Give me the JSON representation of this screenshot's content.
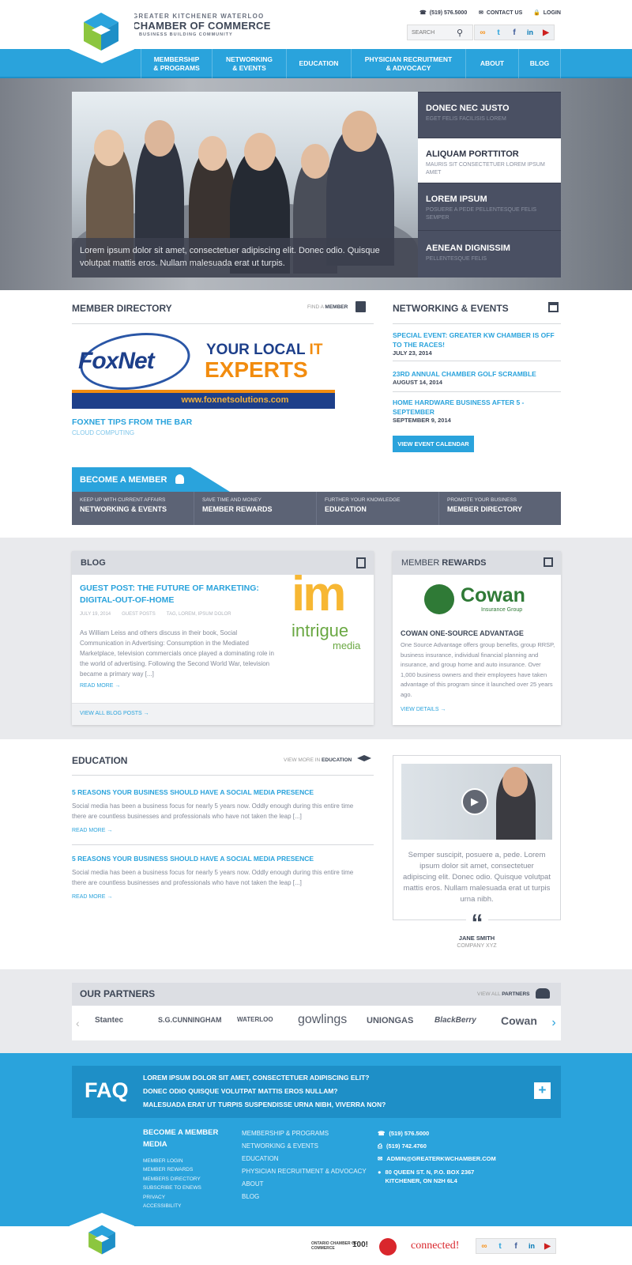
{
  "header": {
    "org_line1": "GREATER KITCHENER WATERLOO",
    "org_line2": "CHAMBER OF COMMERCE",
    "org_line3": "BUSINESS BUILDING COMMUNITY",
    "phone": "(519) 576.5000",
    "contact": "CONTACT US",
    "login": "LOGIN",
    "search_placeholder": "SEARCH",
    "social": [
      "rss-icon",
      "twitter-icon",
      "facebook-icon",
      "linkedin-icon",
      "youtube-icon"
    ]
  },
  "nav": [
    {
      "line1": "MEMBERSHIP",
      "line2": "& PROGRAMS"
    },
    {
      "line1": "NETWORKING",
      "line2": "& EVENTS"
    },
    {
      "line1": "EDUCATION",
      "line2": ""
    },
    {
      "line1": "PHYSICIAN RECRUITMENT",
      "line2": "& ADVOCACY"
    },
    {
      "line1": "ABOUT",
      "line2": ""
    },
    {
      "line1": "BLOG",
      "line2": ""
    }
  ],
  "hero": {
    "caption": "Lorem ipsum dolor sit amet, consectetuer adipiscing elit. Donec odio. Quisque volutpat mattis eros. Nullam malesuada erat ut turpis.",
    "slides": [
      {
        "title": "DONEC NEC JUSTO",
        "sub": "EGET FELIS FACILISIS LOREM"
      },
      {
        "title": "ALIQUAM PORTTITOR",
        "sub": "MAURIS SIT CONSECTETUER LOREM IPSUM AMET"
      },
      {
        "title": "LOREM IPSUM",
        "sub": "POSUERE A PEDE PELLENTESQUE FELIS SEMPER"
      },
      {
        "title": "AENEAN DIGNISSIM",
        "sub": "PELLENTESQUE FELIS"
      }
    ]
  },
  "member_directory": {
    "heading": "MEMBER DIRECTORY",
    "find_pre": "FIND A",
    "find_bold": "MEMBER",
    "ad_brand": "FoxNet",
    "ad_tag1": "YOUR LOCAL",
    "ad_tag_it": "IT",
    "ad_tag2": "EXPERTS",
    "ad_url": "www.foxnetsolutions.com",
    "feature_title": "FOXNET TIPS FROM THE BAR",
    "feature_cat": "CLOUD COMPUTING"
  },
  "events": {
    "heading": "NETWORKING & EVENTS",
    "items": [
      {
        "title": "SPECIAL EVENT: GREATER KW CHAMBER IS OFF TO THE RACES!",
        "date": "JULY 23, 2014"
      },
      {
        "title": "23RD ANNUAL CHAMBER GOLF SCRAMBLE",
        "date": "AUGUST 14, 2014"
      },
      {
        "title": "HOME HARDWARE BUSINESS AFTER 5 - SEPTEMBER",
        "date": "SEPTEMBER 9, 2014"
      }
    ],
    "button": "VIEW EVENT CALENDAR"
  },
  "become_member": {
    "label": "BECOME A MEMBER",
    "cells": [
      {
        "small": "KEEP UP WITH CURRENT AFFAIRS",
        "big": "NETWORKING & EVENTS"
      },
      {
        "small": "SAVE TIME AND MONEY",
        "big": "MEMBER REWARDS"
      },
      {
        "small": "FURTHER YOUR KNOWLEDGE",
        "big": "EDUCATION"
      },
      {
        "small": "PROMOTE YOUR BUSINESS",
        "big": "MEMBER DIRECTORY"
      }
    ]
  },
  "blog": {
    "heading": "BLOG",
    "title": "GUEST POST: THE FUTURE OF MARKETING: DIGITAL-OUT-OF-HOME",
    "date": "JULY 19, 2014",
    "category": "GUEST POSTS",
    "tags": "TAG, LOREM, IPSUM DOLOR",
    "body": "As William Leiss and others discuss in their book, Social Communication in Advertising: Consumption in the Mediated Marketplace, television commercials once played a dominating role in the world of advertising. Following the Second World War, television became a primary way [...]",
    "read_more": "READ MORE →",
    "view_all": "VIEW ALL BLOG POSTS →",
    "logo_im": "im",
    "logo_intrigue": "intrigue",
    "logo_media": "media"
  },
  "rewards": {
    "heading_pre": "MEMBER",
    "heading_bold": "REWARDS",
    "brand": "Cowan",
    "brand_sub": "Insurance Group",
    "title": "COWAN ONE-SOURCE ADVANTAGE",
    "body": "One Source Advantage offers group benefits, group RRSP, business insurance, individual financial planning and insurance, and group home and auto insurance. Over 1,000 business owners and their employees have taken advantage of this program since it launched over 25 years ago.",
    "details": "VIEW DETAILS →"
  },
  "education": {
    "heading": "EDUCATION",
    "view_pre": "VIEW MORE IN",
    "view_bold": "EDUCATION",
    "items": [
      {
        "title": "5 REASONS YOUR BUSINESS SHOULD HAVE A SOCIAL MEDIA PRESENCE",
        "body": "Social media has been a business focus for nearly 5 years now. Oddly enough during this entire time there are countless businesses and professionals who have not taken the leap [...]",
        "more": "READ MORE →"
      },
      {
        "title": "5 REASONS YOUR BUSINESS SHOULD HAVE A SOCIAL MEDIA PRESENCE",
        "body": "Social media has been a business focus for nearly 5 years now. Oddly enough during this entire time there are countless businesses and professionals who have not taken the leap [...]",
        "more": "READ MORE →"
      }
    ],
    "quote": "Semper suscipit, posuere a, pede. Lorem ipsum dolor sit amet, consectetuer adipiscing elit. Donec odio. Quisque volutpat mattis eros. Nullam malesuada erat ut turpis urna nibh.",
    "quote_name": "JANE SMITH",
    "quote_company": "COMPANY XYZ"
  },
  "partners": {
    "heading": "OUR PARTNERS",
    "view_pre": "VIEW ALL",
    "view_bold": "PARTNERS",
    "logos": [
      "Stantec",
      "S.G.CUNNINGHAM",
      "WATERLOO",
      "gowlings",
      "UNIONGAS",
      "BlackBerry",
      "Cowan"
    ]
  },
  "faq": {
    "label": "FAQ",
    "questions": [
      "LOREM IPSUM DOLOR SIT AMET, CONSECTETUER ADIPISCING ELIT?",
      "DONEC ODIO QUISQUE VOLUTPAT MATTIS EROS NULLAM?",
      "MALESUADA ERAT UT TURPIS SUSPENDISSE URNA NIBH, VIVERRA NON?"
    ],
    "expand": "+"
  },
  "footer": {
    "col1_head1": "BECOME A MEMBER",
    "col1_head2": "MEDIA",
    "col1_links": [
      "MEMBER LOGIN",
      "MEMBER REWARDS",
      "MEMBERS DIRECTORY",
      "SUBSCRIBE TO ENEWS",
      "PRIVACY",
      "ACCESSIBILITY"
    ],
    "col2_links": [
      "MEMBERSHIP & PROGRAMS",
      "NETWORKING & EVENTS",
      "EDUCATION",
      "PHYSICIAN RECRUITMENT & ADVOCACY",
      "ABOUT",
      "BLOG"
    ],
    "phone": "(519) 576.5000",
    "fax": "(519) 742.4760",
    "email": "ADMIN@GREATERKWCHAMBER.COM",
    "address1": "80 QUEEN ST. N, P.O. BOX 2367",
    "address2": "KITCHENER, ON  N2H 6L4",
    "badge_ontario": "ONTARIO CHAMBER OF COMMERCE",
    "badge_100": "100!",
    "badge_connected": "connected!"
  },
  "colors": {
    "accent": "#2aa3dc",
    "dark": "#3d4656",
    "slate": "#5c6375"
  }
}
